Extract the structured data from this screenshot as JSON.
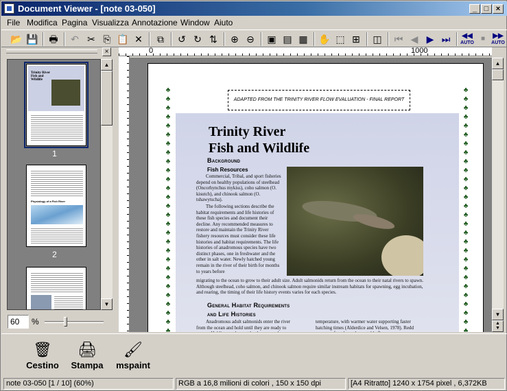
{
  "window": {
    "title": "Document Viewer - [note 03-050]",
    "btn_min": "_",
    "btn_max": "□",
    "btn_close": "×"
  },
  "menu": [
    "File",
    "Modifica",
    "Pagina",
    "Visualizza",
    "Annotazione",
    "Window",
    "Aiuto"
  ],
  "toolbar": {
    "open_icon": "📂",
    "save_icon": "💾",
    "print_icon": "🖶",
    "undo_icon": "↶",
    "cut_icon": "✂",
    "copy_icon": "⎘",
    "paste_icon": "📋",
    "delete_icon": "✕",
    "duplicate_icon": "⧉",
    "rotate_left_icon": "↺",
    "rotate_right_icon": "↻",
    "flip_icon": "⇅",
    "zoom_in_icon": "⊕",
    "zoom_out_icon": "⊖",
    "fit_page_icon": "▣",
    "fit_width_icon": "▤",
    "actual_size_icon": "▦",
    "hand_icon": "✋",
    "select_icon": "⬚",
    "select_zoom_icon": "⊞",
    "panel_icon": "◫",
    "first_icon": "⏮",
    "prev_icon": "◀",
    "next_icon": "▶",
    "last_icon": "⏭",
    "auto_rew_label": "AUTO",
    "stop_icon": "■",
    "auto_fwd_label": "AUTO"
  },
  "thumbnails": {
    "items": [
      {
        "number": "1",
        "title": "Trinity River Fish and Wildlife",
        "selected": true
      },
      {
        "number": "2",
        "title": "Physiology of a Fish River",
        "selected": false
      },
      {
        "number": "",
        "title": "",
        "selected": false
      }
    ],
    "zoom_value": "60",
    "zoom_unit": "%"
  },
  "ruler": {
    "mark_0": "0",
    "mark_1000": "1000"
  },
  "document": {
    "adapted_from": "ADAPTED FROM THE TRINITY RIVER FLOW EVALUATION - FINAL REPORT",
    "title_line1": "Trinity River",
    "title_line2": "Fish and Wildlife",
    "background_heading": "Background",
    "fish_resources_heading": "Fish Resources",
    "para1": "Commercial, Tribal, and sport fisheries depend on healthy populations of steelhead (Oncorhynchus mykiss), coho salmon (O. kisutch), and chinook salmon (O. tshawytscha).",
    "para2": "The following sections describe the habitat requirements and life histories of these fish species and document their decline. Any recommended measures to restore and maintain the Trinity River fishery resources must consider these life histories and habitat requirements. The life histories of anadromous species have two distinct phases, one in freshwater and the other in salt water. Newly hatched young remain in the river of their birth for months to years before",
    "para3": "migrating to the ocean to grow to their adult size. Adult salmonids return from the ocean to their natal rivers to spawn. Although steelhead, coho salmon, and chinook salmon require similar instream habitats for spawning, egg incubation, and rearing, the timing of their life history events varies for each species.",
    "general_heading_line1": "General Habitat Requirements",
    "general_heading_line2": "and Life Histories",
    "para4_left": "Anadromous adult salmonids enter the river from the ocean and hold until they are ready to spawn. Holding pools must be deep enough",
    "para4_right": "temperature, with warmer water supporting faster hatching times (Alderdice and Velsen, 1978). Redd success often depends on stable flows"
  },
  "dock": [
    {
      "label": "Cestino",
      "icon": "🗑"
    },
    {
      "label": "Stampa",
      "icon": "🖨"
    },
    {
      "label": "mspaint",
      "icon": "🖌"
    }
  ],
  "status": {
    "file": "note 03-050 [1 / 10] (60%)",
    "color": "RGB a 16,8 milioni di colori ,  150 x 150 dpi",
    "paper": "[A4 Ritratto]  1240 x 1754 pixel , 6,372KB"
  }
}
